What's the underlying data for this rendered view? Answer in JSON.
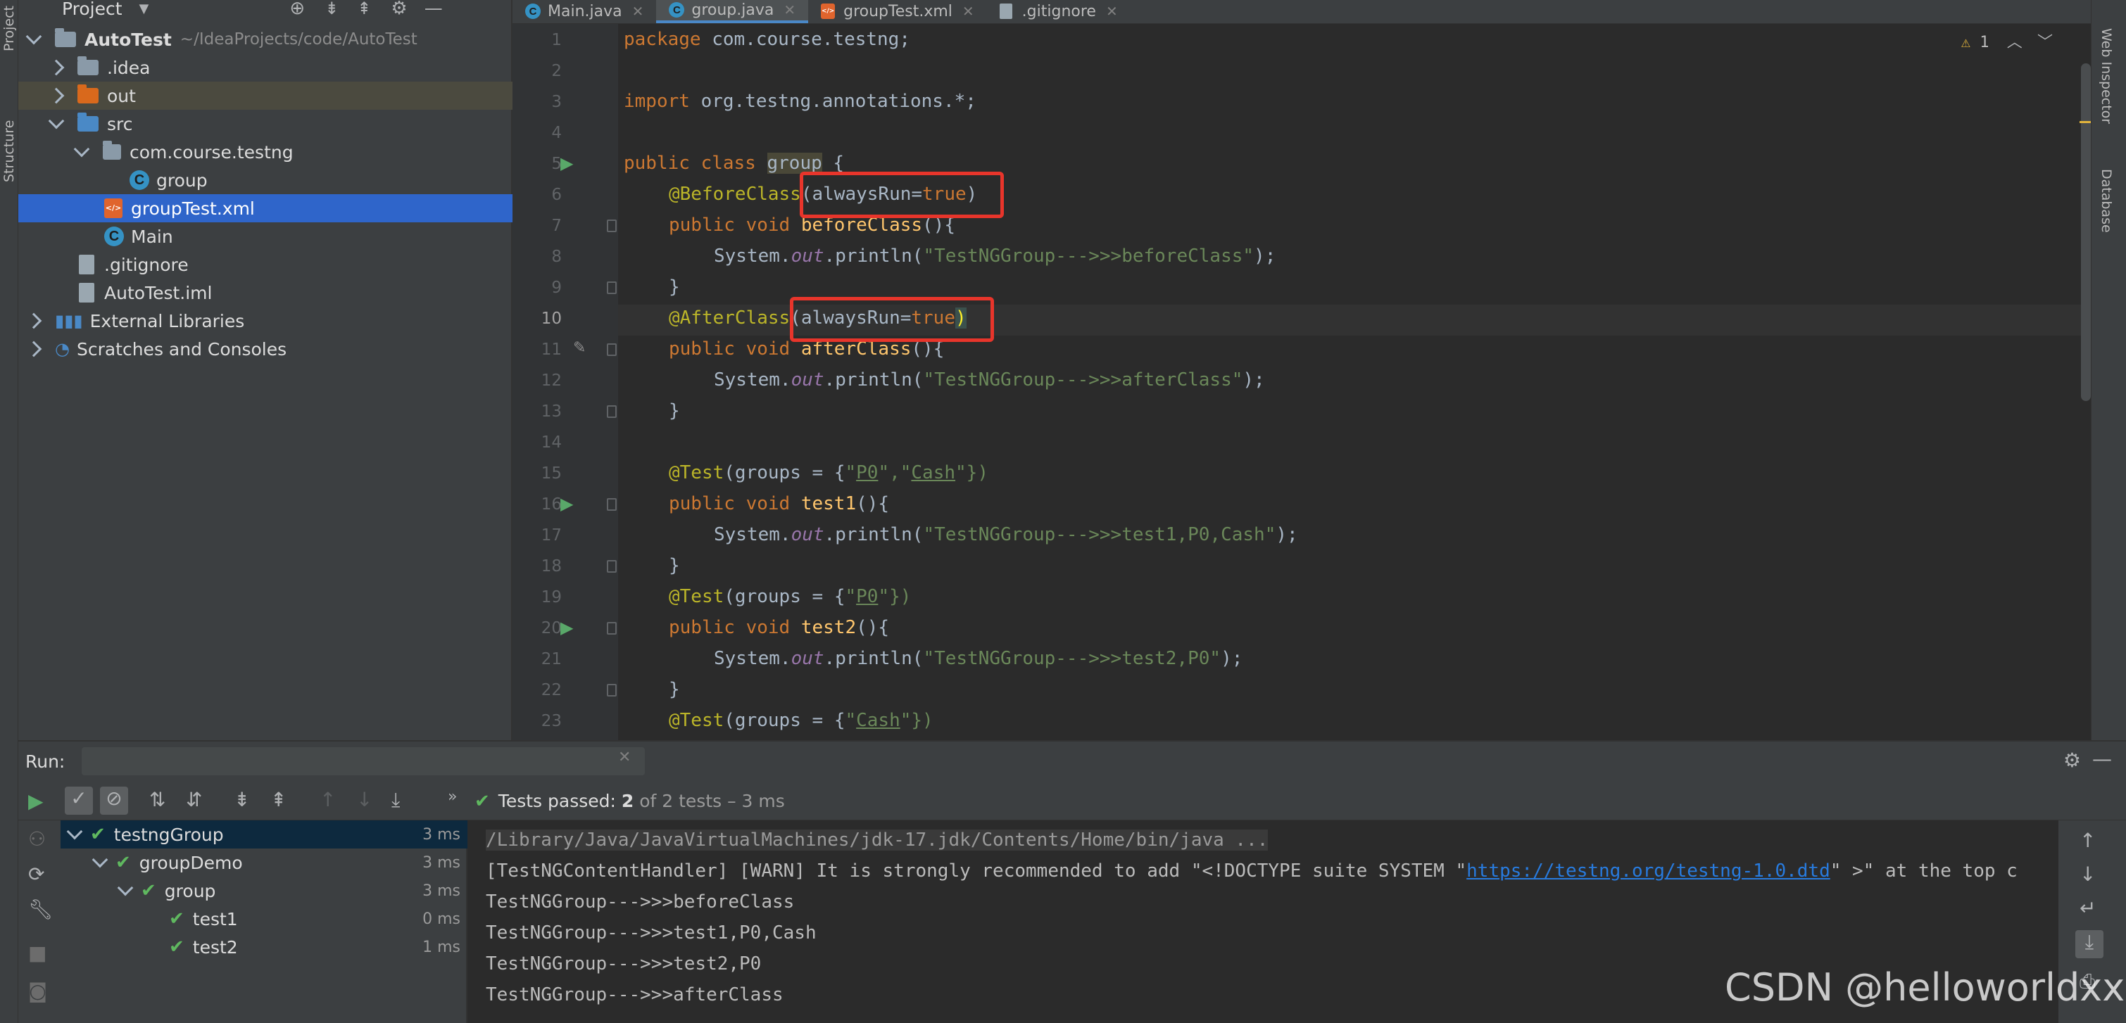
{
  "left_strip": {
    "project_tab": "Project",
    "structure_tab": "Structure"
  },
  "project_panel": {
    "title": "Project",
    "tree": [
      {
        "label": "AutoTest",
        "path": "~/IdeaProjects/code/AutoTest"
      },
      {
        "label": ".idea"
      },
      {
        "label": "out"
      },
      {
        "label": "src"
      },
      {
        "label": "com.course.testng"
      },
      {
        "label": "group"
      },
      {
        "label": "groupTest.xml"
      },
      {
        "label": "Main"
      },
      {
        "label": ".gitignore"
      },
      {
        "label": "AutoTest.iml"
      },
      {
        "label": "External Libraries"
      },
      {
        "label": "Scratches and Consoles"
      }
    ]
  },
  "editor": {
    "tabs": [
      {
        "label": "Main.java",
        "icon": "class-icon"
      },
      {
        "label": "group.java",
        "icon": "class-icon"
      },
      {
        "label": "groupTest.xml",
        "icon": "xml-file-icon"
      },
      {
        "label": ".gitignore",
        "icon": "gitignore-file-icon"
      }
    ],
    "active_tab": "group.java",
    "warnings": "1",
    "current_line": "10",
    "lines": [
      "1",
      "2",
      "3",
      "4",
      "5",
      "6",
      "7",
      "8",
      "9",
      "10",
      "11",
      "12",
      "13",
      "14",
      "15",
      "16",
      "17",
      "18",
      "19",
      "20",
      "21",
      "22",
      "23"
    ]
  },
  "code": {
    "l1": {
      "kw": "package",
      "rest": " com.course.testng;"
    },
    "l3": {
      "kw": "import",
      "rest": " org.testng.annotations.*;"
    },
    "l5": {
      "kw": "public class",
      "sp": " ",
      "cls": "group",
      "rest": " {"
    },
    "l6": {
      "ann": "@BeforeClass",
      "p1": "(alwaysRun=",
      "kw": "true",
      "p2": ")"
    },
    "l7": {
      "kw": "public void",
      "fn": "beforeClass",
      "rest": "(){"
    },
    "l8": {
      "pre": "System.",
      "out": "out",
      "mid": ".println(",
      "str": "\"TestNGGroup--->>>beforeClass\"",
      "end": ");"
    },
    "l9": "}",
    "l10": {
      "ann": "@AfterClass",
      "p1": "(alwaysRun=",
      "kw": "true",
      "p2": ")"
    },
    "l11": {
      "kw": "public void",
      "fn": "afterClass",
      "rest": "(){"
    },
    "l12": {
      "pre": "System.",
      "out": "out",
      "mid": ".println(",
      "str": "\"TestNGGroup--->>>afterClass\"",
      "end": ");"
    },
    "l13": "}",
    "l15": {
      "ann": "@Test",
      "p1": "(groups = {",
      "q": "\"",
      "g1": "P0",
      "sep": "\",\"",
      "g2": "Cash",
      "p2": "\"})"
    },
    "l16": {
      "kw": "public void",
      "fn": "test1",
      "rest": "(){"
    },
    "l17": {
      "pre": "System.",
      "out": "out",
      "mid": ".println(",
      "str": "\"TestNGGroup--->>>test1,P0,Cash\"",
      "end": ");"
    },
    "l18": "}",
    "l19": {
      "ann": "@Test",
      "p1": "(groups = {",
      "q": "\"",
      "g1": "P0",
      "p2": "\"})"
    },
    "l20": {
      "kw": "public void",
      "fn": "test2",
      "rest": "(){"
    },
    "l21": {
      "pre": "System.",
      "out": "out",
      "mid": ".println(",
      "str": "\"TestNGGroup--->>>test2,P0\"",
      "end": ");"
    },
    "l22": "}",
    "l23": {
      "ann": "@Test",
      "p1": "(groups = {",
      "q": "\"",
      "g1": "Cash",
      "p2": "\"})"
    }
  },
  "right_strip": {
    "web_inspector": "Web Inspector",
    "database": "Database"
  },
  "run": {
    "label": "Run:",
    "status_prefix": "Tests passed: ",
    "passed": "2",
    "status_suffix": " of 2 tests – 3 ms",
    "results": [
      {
        "name": "testngGroup",
        "time": "3 ms"
      },
      {
        "name": "groupDemo",
        "time": "3 ms"
      },
      {
        "name": "group",
        "time": "3 ms"
      },
      {
        "name": "test1",
        "time": "0 ms"
      },
      {
        "name": "test2",
        "time": "1 ms"
      }
    ],
    "console": {
      "cmd": "/Library/Java/JavaVirtualMachines/jdk-17.jdk/Contents/Home/bin/java ...",
      "warn_prefix": "[TestNGContentHandler] [WARN] It is strongly recommended to add \"<!DOCTYPE suite SYSTEM \"",
      "warn_link": "https://testng.org/testng-1.0.dtd",
      "warn_suffix": "\" >\" at the top c",
      "out1": "TestNGGroup--->>>beforeClass",
      "out2": "TestNGGroup--->>>test1,P0,Cash",
      "out3": "TestNGGroup--->>>test2,P0",
      "out4": "TestNGGroup--->>>afterClass"
    }
  },
  "watermark": "CSDN @helloworldxxd",
  "colors": {
    "accent": "#2f65ca",
    "highlight_box": "#e8352b",
    "pass": "#5fb85f"
  }
}
